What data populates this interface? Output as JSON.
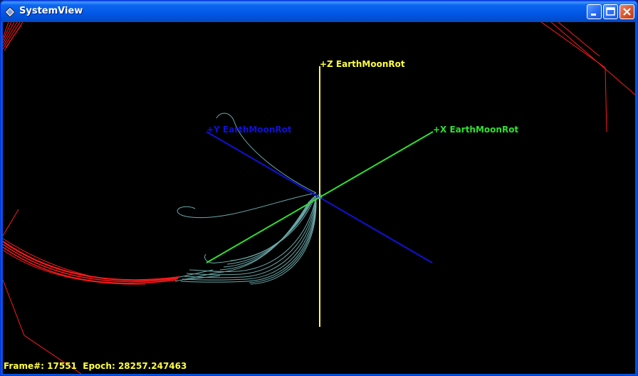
{
  "window": {
    "title": "SystemView",
    "icon": "systemview-app-icon",
    "controls": {
      "minimize": "minimize-icon",
      "maximize": "maximize-icon",
      "close": "close-icon"
    }
  },
  "axes": {
    "z_label": "+Z EarthMoonRot",
    "y_label": "+Y EarthMoonRot",
    "x_label": "+X EarthMoonRot"
  },
  "colors": {
    "z_axis": "#ffff40",
    "y_axis": "#1010d8",
    "x_axis": "#30e030",
    "trajectory": "#6aa8a8",
    "orbit": "#ff1a1a",
    "status_text": "#ffff40",
    "background": "#000000"
  },
  "status": {
    "frame_label": "Frame#:",
    "frame_value": "17551",
    "epoch_label": "Epoch:",
    "epoch_value": "28257.247463"
  }
}
